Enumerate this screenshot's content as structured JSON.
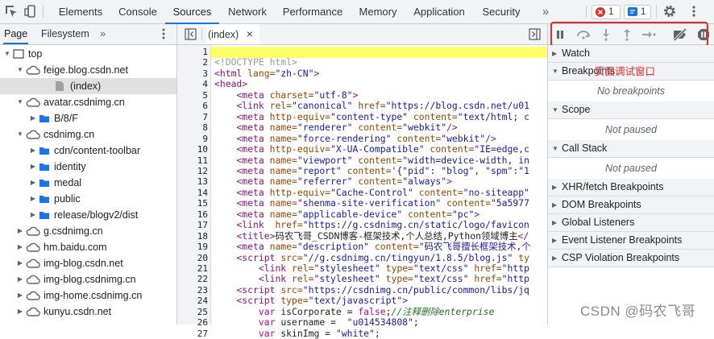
{
  "toolbar": {
    "tabs": [
      "Elements",
      "Console",
      "Sources",
      "Network",
      "Performance",
      "Memory",
      "Application",
      "Security"
    ],
    "active_tab": "Sources",
    "more": "»",
    "error_count": "1",
    "message_count": "1"
  },
  "navigator": {
    "tabs": [
      "Page",
      "Filesystem"
    ],
    "tree": [
      {
        "label": "top",
        "type": "frame",
        "depth": 0,
        "expanded": true
      },
      {
        "label": "feige.blog.csdn.net",
        "type": "cloud",
        "depth": 1,
        "expanded": true
      },
      {
        "label": "(index)",
        "type": "file",
        "depth": 2,
        "selected": true
      },
      {
        "label": "avatar.csdnimg.cn",
        "type": "cloud",
        "depth": 1,
        "expanded": true
      },
      {
        "label": "B/8/F",
        "type": "folder",
        "depth": 2,
        "expanded": false
      },
      {
        "label": "csdnimg.cn",
        "type": "cloud",
        "depth": 1,
        "expanded": true
      },
      {
        "label": "cdn/content-toolbar",
        "type": "folder",
        "depth": 2,
        "expanded": false
      },
      {
        "label": "identity",
        "type": "folder",
        "depth": 2,
        "expanded": false
      },
      {
        "label": "medal",
        "type": "folder",
        "depth": 2,
        "expanded": false
      },
      {
        "label": "public",
        "type": "folder",
        "depth": 2,
        "expanded": false
      },
      {
        "label": "release/blogv2/dist",
        "type": "folder",
        "depth": 2,
        "expanded": false
      },
      {
        "label": "g.csdnimg.cn",
        "type": "cloud",
        "depth": 1,
        "expanded": false
      },
      {
        "label": "hm.baidu.com",
        "type": "cloud",
        "depth": 1,
        "expanded": false
      },
      {
        "label": "img-blog.csdn.net",
        "type": "cloud",
        "depth": 1,
        "expanded": false
      },
      {
        "label": "img-blog.csdnimg.cn",
        "type": "cloud",
        "depth": 1,
        "expanded": false
      },
      {
        "label": "img-home.csdnimg.cn",
        "type": "cloud",
        "depth": 1,
        "expanded": false
      },
      {
        "label": "kunyu.csdn.net",
        "type": "cloud",
        "depth": 1,
        "expanded": false
      }
    ]
  },
  "editor": {
    "tab_label": "(index)",
    "close": "×",
    "lines": [
      {
        "n": "1",
        "html": ""
      },
      {
        "n": "2",
        "html": "<span class='t-doc'>&lt;!DOCTYPE html&gt;</span>"
      },
      {
        "n": "3",
        "html": "<span class='t-tag'>&lt;html</span> <span class='t-attr'>lang=</span><span class='t-val'>\"zh-CN\"</span><span class='t-tag'>&gt;</span>"
      },
      {
        "n": "4",
        "html": "<span class='t-tag'>&lt;head&gt;</span>"
      },
      {
        "n": "5",
        "html": "    <span class='t-tag'>&lt;meta</span> <span class='t-attr'>charset=</span><span class='t-val'>\"utf-8\"</span><span class='t-tag'>&gt;</span>"
      },
      {
        "n": "6",
        "html": "    <span class='t-tag'>&lt;link</span> <span class='t-attr'>rel=</span><span class='t-val'>\"canonical\"</span> <span class='t-attr'>href=</span><span class='t-val'>\"https://blog.csdn.net/u01</span>"
      },
      {
        "n": "7",
        "html": "    <span class='t-tag'>&lt;meta</span> <span class='t-attr'>http-equiv=</span><span class='t-val'>\"content-type\"</span> <span class='t-attr'>content=</span><span class='t-val'>\"text/html; c</span>"
      },
      {
        "n": "8",
        "html": "    <span class='t-tag'>&lt;meta</span> <span class='t-attr'>name=</span><span class='t-val'>\"renderer\"</span> <span class='t-attr'>content=</span><span class='t-val'>\"webkit\"</span><span class='t-tag'>/&gt;</span>"
      },
      {
        "n": "9",
        "html": "    <span class='t-tag'>&lt;meta</span> <span class='t-attr'>name=</span><span class='t-val'>\"force-rendering\"</span> <span class='t-attr'>content=</span><span class='t-val'>\"webkit\"</span><span class='t-tag'>/&gt;</span>"
      },
      {
        "n": "10",
        "html": "    <span class='t-tag'>&lt;meta</span> <span class='t-attr'>http-equiv=</span><span class='t-val'>\"X-UA-Compatible\"</span> <span class='t-attr'>content=</span><span class='t-val'>\"IE=edge,c</span>"
      },
      {
        "n": "11",
        "html": "    <span class='t-tag'>&lt;meta</span> <span class='t-attr'>name=</span><span class='t-val'>\"viewport\"</span> <span class='t-attr'>content=</span><span class='t-val'>\"width=device-width, in</span>"
      },
      {
        "n": "12",
        "html": "    <span class='t-tag'>&lt;meta</span> <span class='t-attr'>name=</span><span class='t-val'>\"report\"</span> <span class='t-attr'>content=</span><span class='t-val'>'{\"pid\": \"blog\", \"spm\":\"1</span>"
      },
      {
        "n": "13",
        "html": "    <span class='t-tag'>&lt;meta</span> <span class='t-attr'>name=</span><span class='t-val'>\"referrer\"</span> <span class='t-attr'>content=</span><span class='t-val'>\"always\"</span><span class='t-tag'>&gt;</span>"
      },
      {
        "n": "14",
        "html": "    <span class='t-tag'>&lt;meta</span> <span class='t-attr'>http-equiv=</span><span class='t-val'>\"Cache-Control\"</span> <span class='t-attr'>content=</span><span class='t-val'>\"no-siteapp\"</span>"
      },
      {
        "n": "15",
        "html": "    <span class='t-tag'>&lt;meta</span> <span class='t-attr'>name=</span><span class='t-val'>\"shenma-site-verification\"</span> <span class='t-attr'>content=</span><span class='t-val'>\"5a5977</span>"
      },
      {
        "n": "16",
        "html": "    <span class='t-tag'>&lt;meta</span> <span class='t-attr'>name=</span><span class='t-val'>\"applicable-device\"</span> <span class='t-attr'>content=</span><span class='t-val'>\"pc\"</span><span class='t-tag'>&gt;</span>"
      },
      {
        "n": "17",
        "html": "    <span class='t-tag'>&lt;link</span>  <span class='t-attr'>href=</span><span class='t-val'>\"https://g.csdnimg.cn/static/logo/favicon</span>"
      },
      {
        "n": "18",
        "html": "    <span class='t-tag'>&lt;title&gt;</span><span class='t-text'>码农飞哥_CSDN博客-框架技术,个人总结,Python领域博主</span><span class='t-tag'>&lt;/</span>"
      },
      {
        "n": "19",
        "html": "    <span class='t-tag'>&lt;meta</span> <span class='t-attr'>name=</span><span class='t-val'>\"description\"</span> <span class='t-attr'>content=</span><span class='t-val'>\"码农飞哥擅长框架技术,个</span>"
      },
      {
        "n": "20",
        "html": "    <span class='t-tag'>&lt;script</span> <span class='t-attr'>src=</span><span class='t-val'>\"//g.csdnimg.cn/tingyun/1.8.5/blog.js\"</span> <span class='t-attr'>ty</span>"
      },
      {
        "n": "21",
        "html": "        <span class='t-tag'>&lt;link</span> <span class='t-attr'>rel=</span><span class='t-val'>\"stylesheet\"</span> <span class='t-attr'>type=</span><span class='t-val'>\"text/css\"</span> <span class='t-attr'>href=</span><span class='t-val'>\"http</span>"
      },
      {
        "n": "22",
        "html": "        <span class='t-tag'>&lt;link</span> <span class='t-attr'>rel=</span><span class='t-val'>\"stylesheet\"</span> <span class='t-attr'>type=</span><span class='t-val'>\"text/css\"</span> <span class='t-attr'>href=</span><span class='t-val'>\"http</span>"
      },
      {
        "n": "23",
        "html": "    <span class='t-tag'>&lt;script</span> <span class='t-attr'>src=</span><span class='t-val'>\"https://csdnimg.cn/public/common/libs/jq</span>"
      },
      {
        "n": "24",
        "html": "    <span class='t-tag'>&lt;script</span> <span class='t-attr'>type=</span><span class='t-val'>\"text/javascript\"</span><span class='t-tag'>&gt;</span>"
      },
      {
        "n": "25",
        "html": "        <span class='t-kw'>var</span> <span class='t-js'>isCorporate = </span><span class='t-kw'>false</span><span class='t-js'>;</span><span class='t-com'>//注释删除enterprise</span>"
      },
      {
        "n": "26",
        "html": "        <span class='t-kw'>var</span> <span class='t-js'>username =  </span><span class='t-str'>\"u014534808\"</span><span class='t-js'>;</span>"
      },
      {
        "n": "27",
        "html": "        <span class='t-kw'>var</span> <span class='t-js'>skinImg = </span><span class='t-str'>\"white\"</span><span class='t-js'>;</span>"
      }
    ]
  },
  "debugger": {
    "sections": [
      {
        "label": "Watch",
        "expanded": false
      },
      {
        "label": "Breakpoints",
        "expanded": true,
        "body": "No breakpoints"
      },
      {
        "label": "Scope",
        "expanded": true,
        "body": "Not paused"
      },
      {
        "label": "Call Stack",
        "expanded": true,
        "body": "Not paused"
      },
      {
        "label": "XHR/fetch Breakpoints",
        "expanded": false
      },
      {
        "label": "DOM Breakpoints",
        "expanded": false
      },
      {
        "label": "Global Listeners",
        "expanded": false
      },
      {
        "label": "Event Listener Breakpoints",
        "expanded": false
      },
      {
        "label": "CSP Violation Breakpoints",
        "expanded": false
      }
    ]
  },
  "annotation": "页面调试窗口",
  "watermark": "CSDN @码农飞哥",
  "colors": {
    "accent": "#1a73e8",
    "highlight": "#e8282a",
    "exec_line": "#ffff6a",
    "folder": "#1a73e8"
  }
}
